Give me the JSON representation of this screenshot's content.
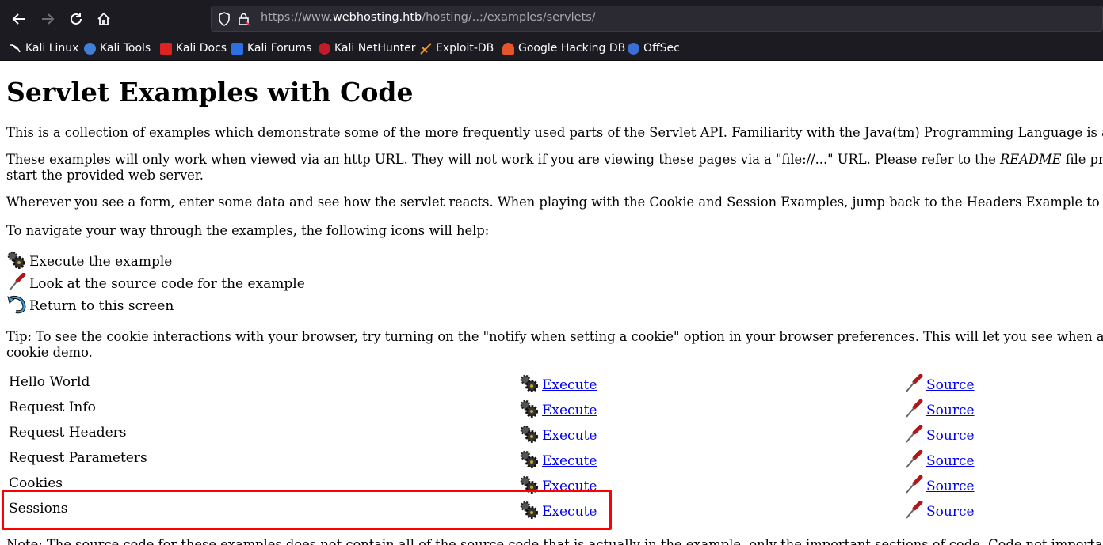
{
  "browser": {
    "url_prefix": "https://www.",
    "url_domain": "webhosting.htb",
    "url_path": "/hosting/..;/examples/servlets/",
    "bookmarks": [
      {
        "label": "Kali Linux",
        "icon": "kali-dragon-icon"
      },
      {
        "label": "Kali Tools",
        "icon": "kali-tools-icon"
      },
      {
        "label": "Kali Docs",
        "icon": "kali-docs-icon"
      },
      {
        "label": "Kali Forums",
        "icon": "kali-forums-icon"
      },
      {
        "label": "Kali NetHunter",
        "icon": "kali-nethunter-icon"
      },
      {
        "label": "Exploit-DB",
        "icon": "exploit-db-icon"
      },
      {
        "label": "Google Hacking DB",
        "icon": "ghdb-icon"
      },
      {
        "label": "OffSec",
        "icon": "offsec-icon"
      }
    ]
  },
  "page": {
    "title": "Servlet Examples with Code",
    "para1": "This is a collection of examples which demonstrate some of the more frequently used parts of the Servlet API. Familiarity with the Java(tm) Programming Language is ass",
    "para2_line1_a": "These examples will only work when viewed via an http URL. They will not work if you are viewing these pages via a \"file://...\" URL. Please refer to the ",
    "para2_line1_em": "README",
    "para2_line1_b": " file provi",
    "para2_line2": "start the provided web server.",
    "para3": "Wherever you see a form, enter some data and see how the servlet reacts. When playing with the Cookie and Session Examples, jump back to the Headers Example to see",
    "para4": "To navigate your way through the examples, the following icons will help:",
    "legend": {
      "execute": "Execute the example",
      "source": "Look at the source code for the example",
      "return": "Return to this screen"
    },
    "tip_line1": "Tip: To see the cookie interactions with your browser, try turning on the \"notify when setting a cookie\" option in your browser preferences. This will let you see when a se",
    "tip_line2": "cookie demo.",
    "examples": [
      {
        "name": "Hello World",
        "execute": "Execute",
        "source": "Source"
      },
      {
        "name": "Request Info",
        "execute": "Execute",
        "source": "Source"
      },
      {
        "name": "Request Headers",
        "execute": "Execute",
        "source": "Source"
      },
      {
        "name": "Request Parameters",
        "execute": "Execute",
        "source": "Source"
      },
      {
        "name": "Cookies",
        "execute": "Execute",
        "source": "Source"
      },
      {
        "name": "Sessions",
        "execute": "Execute",
        "source": "Source"
      }
    ],
    "note": "Note: The source code for these examples does not contain all of the source code that is actually in the example, only the important sections of code. Code not important t"
  }
}
